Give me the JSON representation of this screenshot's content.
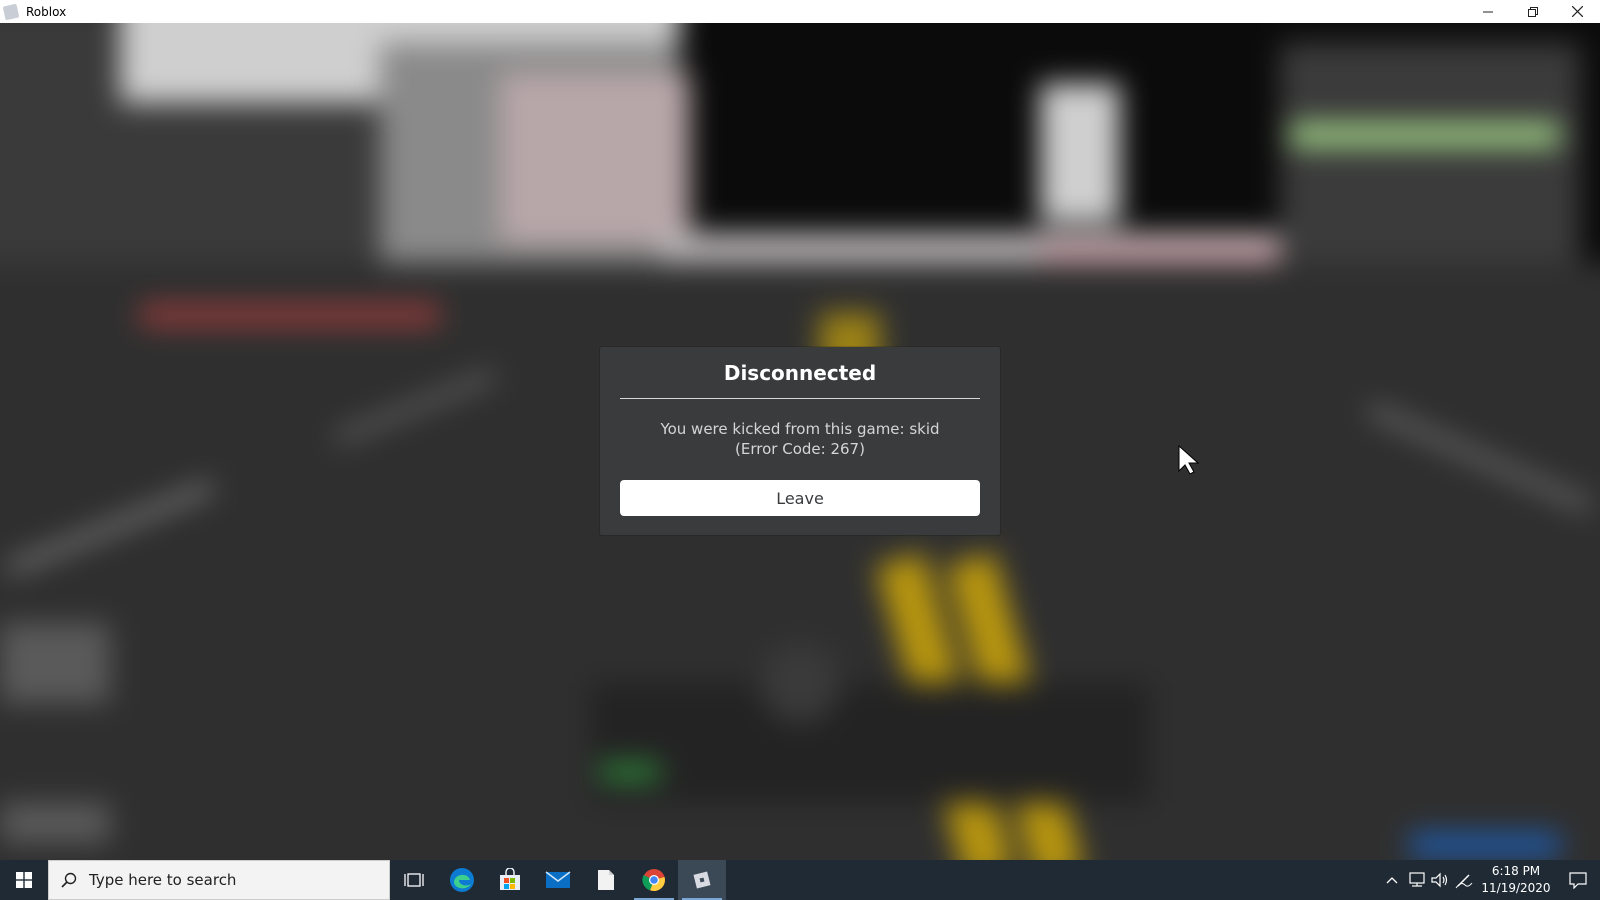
{
  "window": {
    "title": "Roblox",
    "app_icon": "roblox-icon",
    "controls": [
      "minimize-icon",
      "restore-icon",
      "close-icon"
    ]
  },
  "dialog": {
    "title": "Disconnected",
    "message_line1": "You were kicked from this game: skid",
    "message_line2": "(Error Code: 267)",
    "leave_label": "Leave"
  },
  "taskbar": {
    "search_placeholder": "Type here to search",
    "apps": [
      "task-view-icon",
      "edge-icon",
      "store-icon",
      "mail-icon",
      "file-icon",
      "chrome-icon",
      "roblox-icon"
    ],
    "tray_icons": [
      "chevron-up-icon",
      "network-icon",
      "volume-icon",
      "pen-icon"
    ],
    "time": "6:18 PM",
    "date": "11/19/2020"
  },
  "colors": {
    "dialog_bg": "#393b3d",
    "taskbar_bg": "#1f2a35",
    "button_bg": "#ffffff"
  }
}
